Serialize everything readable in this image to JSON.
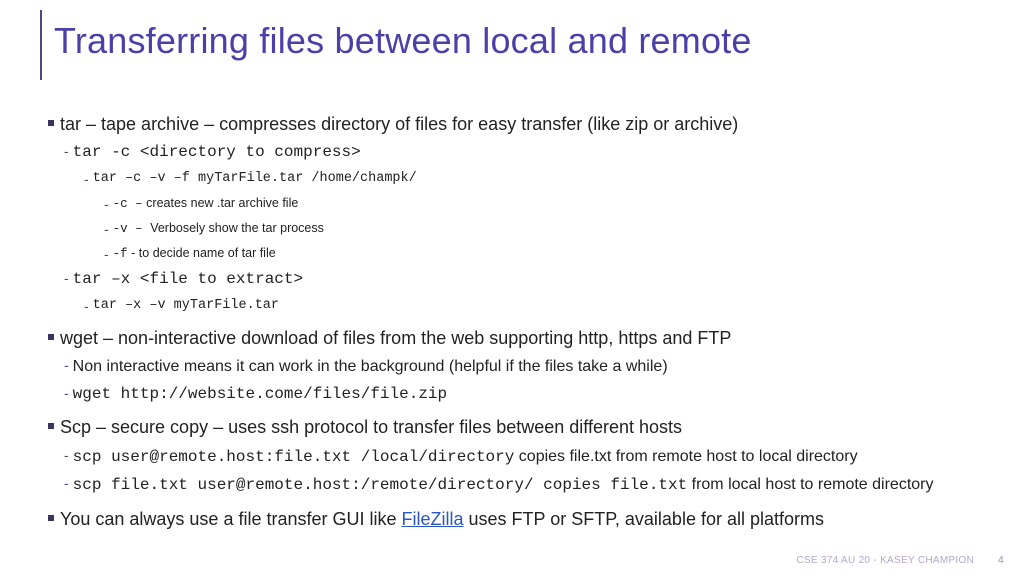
{
  "title": "Transferring files between local and remote",
  "tar": {
    "head": "tar – tape archive – compresses directory of files for easy transfer (like zip or archive)",
    "cmd_c": "tar -c <directory to compress>",
    "ex_c": "tar –c –v –f myTarFile.tar /home/champk/",
    "flag_c_code": "-c –",
    "flag_c_text": " creates new .tar archive file",
    "flag_v_code": "-v – ",
    "flag_v_text": " Verbosely show the tar process",
    "flag_f_code": "-f",
    "flag_f_text": " - to decide name of tar file",
    "cmd_x": "tar –x <file to extract>",
    "ex_x": "tar –x –v myTarFile.tar"
  },
  "wget": {
    "head": "wget – non-interactive download of files from the web supporting http, https and FTP",
    "note": "Non interactive means it can work in the background (helpful if the files take a while)",
    "cmd": "wget http://website.come/files/file.zip"
  },
  "scp": {
    "head": "Scp – secure copy – uses ssh protocol to transfer files between different hosts",
    "line1_code": "scp user@remote.host:file.txt /local/directory",
    "line1_text": " copies file.txt from remote host to local directory",
    "line2_code": "scp file.txt user@remote.host:/remote/directory/ copies file.txt",
    "line2_text": " from local host to remote directory"
  },
  "gui": {
    "pre": "You can always use a file transfer GUI like ",
    "link": "FileZilla",
    "post": " uses FTP or SFTP, available for all platforms"
  },
  "footer": {
    "course": "CSE 374 AU 20 - KASEY CHAMPION",
    "page": "4"
  }
}
